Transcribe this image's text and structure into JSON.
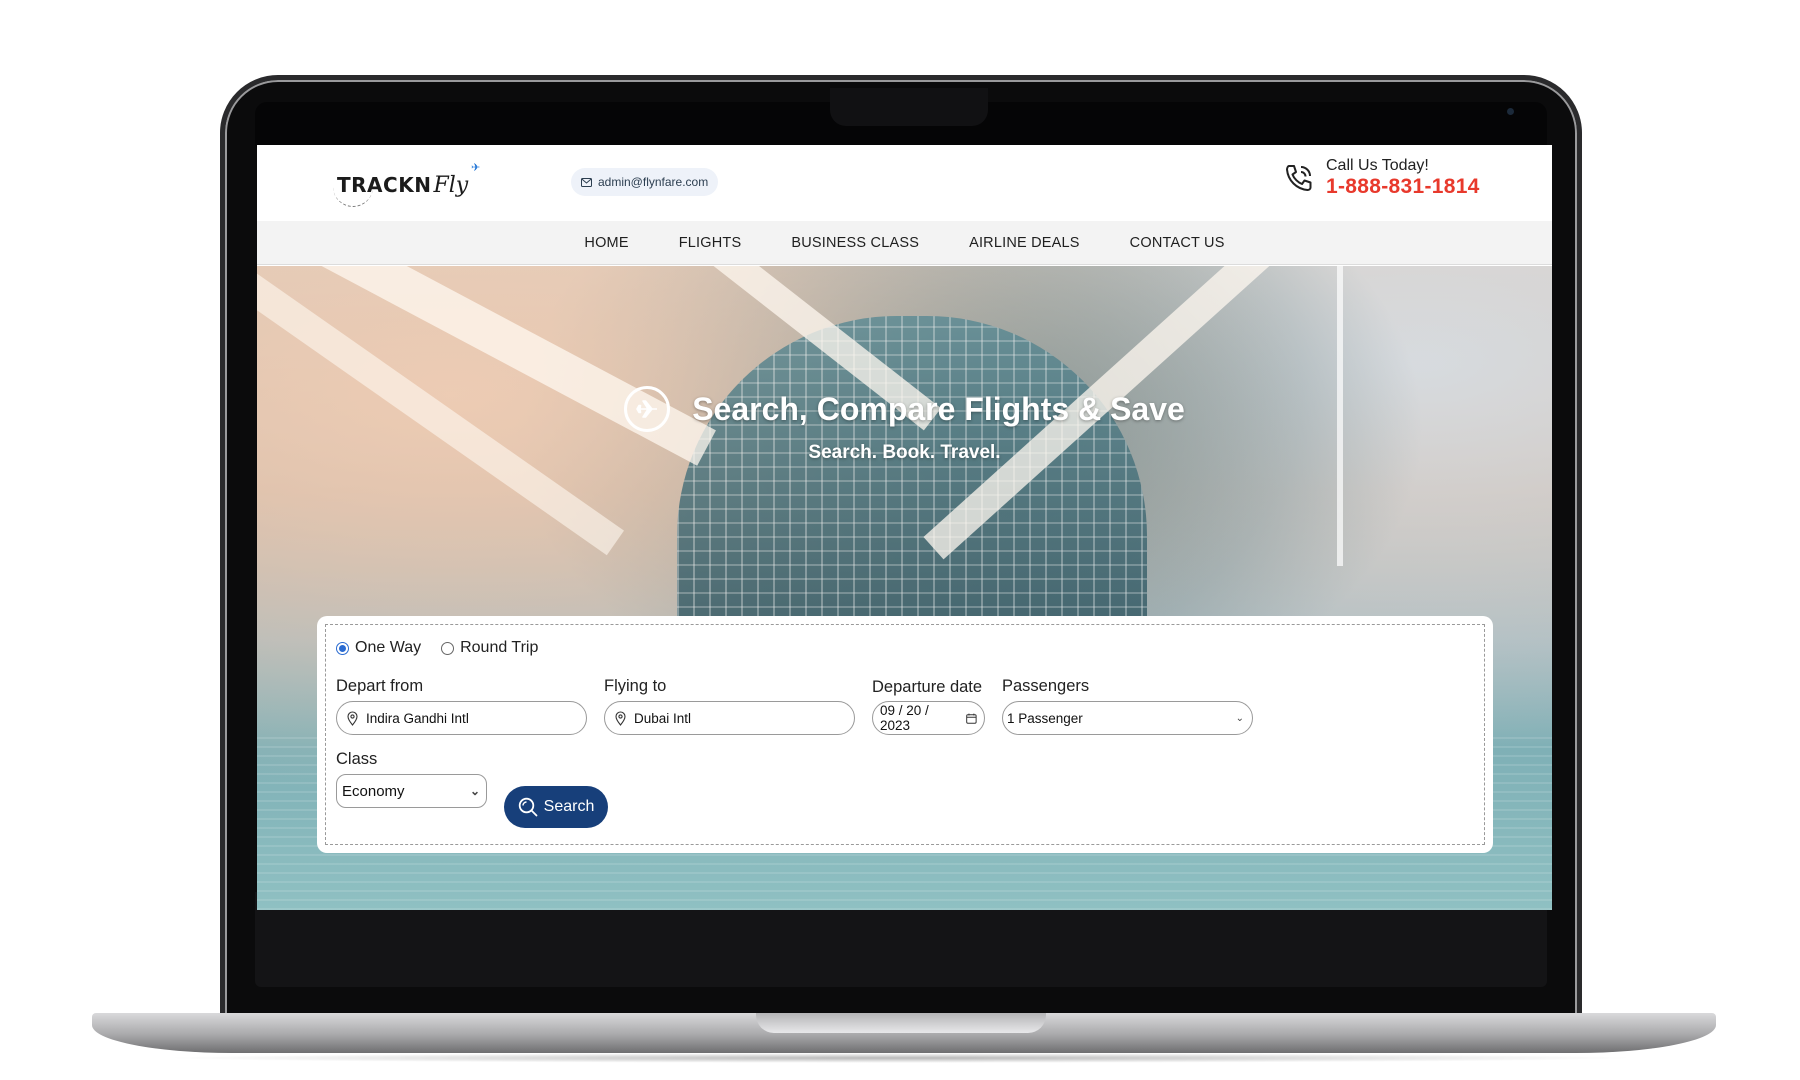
{
  "header": {
    "logo_text": "TRACKN",
    "logo_script": "Fly",
    "email": "admin@flynfare.com",
    "call_label": "Call Us Today!",
    "phone": "1-888-831-1814"
  },
  "nav": {
    "items": [
      {
        "label": "HOME"
      },
      {
        "label": "FLIGHTS"
      },
      {
        "label": "BUSINESS CLASS"
      },
      {
        "label": "AIRLINE DEALS"
      },
      {
        "label": "CONTACT US"
      }
    ]
  },
  "hero": {
    "title": "Search, Compare Flights & Save",
    "subtitle": "Search. Book. Travel."
  },
  "search": {
    "trip_types": [
      {
        "label": "One Way",
        "checked": true
      },
      {
        "label": "Round Trip",
        "checked": false
      }
    ],
    "depart_label": "Depart from",
    "depart_value": "Indira Gandhi Intl",
    "flying_label": "Flying to",
    "flying_value": "Dubai Intl",
    "date_label": "Departure date",
    "date_value": "09 / 20 / 2023",
    "passengers_label": "Passengers",
    "passengers_value": "1 Passenger",
    "class_label": "Class",
    "class_value": "Economy",
    "search_button": "Search"
  },
  "colors": {
    "accent": "#173f7a",
    "phone": "#e8392c",
    "radio": "#2a6bd1"
  },
  "icons": {
    "email": "mail-icon",
    "phone": "phone-icon",
    "plane": "plane-icon",
    "location": "location-pin-icon",
    "calendar": "calendar-icon",
    "chevron": "chevron-down-icon",
    "search": "search-icon"
  }
}
